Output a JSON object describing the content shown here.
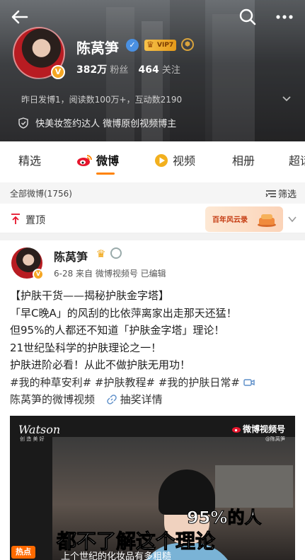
{
  "profile": {
    "name": "陈莴笋",
    "vip_label": "VIP7",
    "followers": "382万",
    "followers_label": "粉丝",
    "following": "464",
    "following_label": "关注",
    "summary": "昨日发博1，阅读数100万+，互动数2190",
    "certification": "快美妆签约达人 微博原创视频博主"
  },
  "tabs": [
    {
      "label": "精选"
    },
    {
      "label": "微博"
    },
    {
      "label": "视频"
    },
    {
      "label": "相册"
    },
    {
      "label": "超话"
    }
  ],
  "filter": {
    "count_label": "全部微博(1756)",
    "filter_label": "筛选"
  },
  "pinned": {
    "label": "置顶",
    "promo_text": "百年风云录"
  },
  "post": {
    "author": "陈莴笋",
    "meta": "6-28  来自 微博视频号  已编辑",
    "lines": [
      "【护肤干货——揭秘护肤金字塔】",
      "「早C晚A」的风刮的比依萍离家出走那天还猛！",
      "但95%的人都还不知道「护肤金字塔」理论！",
      "21世纪坠科学的护肤理论之一！",
      "护肤进阶必看！从此不做护肤无用功！"
    ],
    "tags_line": "#我的种草安利# #护肤教程# #我的护肤日常#",
    "video_link": "陈莴笋的微博视频",
    "lottery_link": "抽奖详情"
  },
  "video": {
    "brand": "Watson",
    "brand_sub": "创 造 美 好",
    "watermark": "微博视频号",
    "handle": "@陈莴笋",
    "caption_big": "95%的人",
    "caption_main": "都不了解这个理论",
    "caption_sub": "上个世纪的化妆品有多粗糙",
    "hot_label": "热点"
  },
  "colors": {
    "accent": "#ff8200",
    "link": "#5b8dc8"
  }
}
